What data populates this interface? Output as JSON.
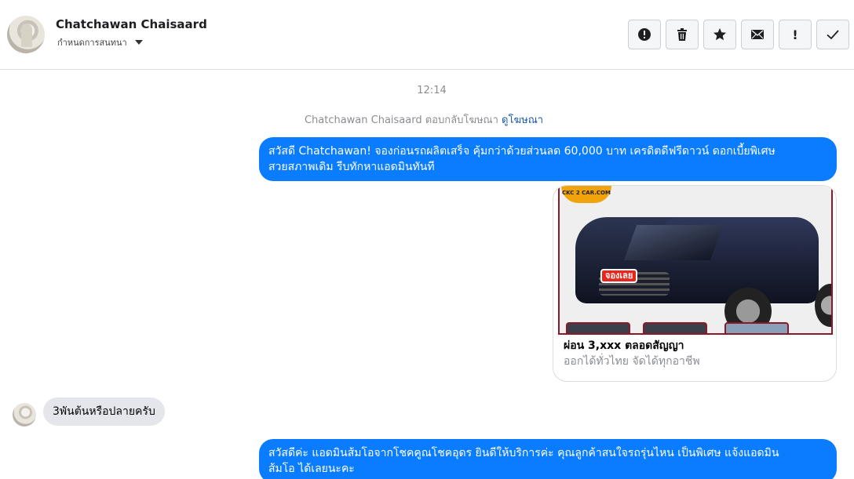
{
  "header": {
    "contact_name": "Chatchawan Chaisaard",
    "conversation_settings_label": "กำหนดการสนทนา"
  },
  "toolbar": {
    "buttons": [
      {
        "name": "report",
        "icon": "alert-circle-icon"
      },
      {
        "name": "delete",
        "icon": "trash-icon"
      },
      {
        "name": "star",
        "icon": "star-icon"
      },
      {
        "name": "mark-unread",
        "icon": "envelope-icon"
      },
      {
        "name": "spam",
        "icon": "exclamation-icon",
        "label": "!"
      },
      {
        "name": "done",
        "icon": "check-icon"
      }
    ]
  },
  "thread": {
    "timestamp": "12:14",
    "ad_reply_prefix": "Chatchawan Chaisaard ตอบกลับโฆษณา",
    "ad_reply_link": "ดูโฆษณา",
    "messages": [
      {
        "direction": "outgoing",
        "text_line1": "สวัสดี Chatchawan! จองก่อนรถผลิตเสร็จ คุ้มกว่าด้วยส่วนลด 60,000 บาท เครดิตดีฟรีดาวน์ ดอกเบี้ยพิเศษ",
        "text_line2": "สวยสภาพเดิม รีบทักหาแอดมินทันที"
      },
      {
        "direction": "incoming",
        "text": "3พันต้นหรือปลายครับ"
      },
      {
        "direction": "outgoing",
        "text_line1": "สวัสดีค่ะ แอดมินส้มโอจากโชคคูณโชคอุดร ยินดีให้บริการค่ะ   คุณลูกค้าสนใจรถรุ่นไหน เป็นพิเศษ แจ้งแอดมิน",
        "text_line2": "ส้มโอ ได้เลยนะคะ"
      }
    ],
    "ad_card": {
      "image_logo_text": "CKC 2 CAR.COM",
      "image_badge_text": "จองเลย",
      "title": "ผ่อน 3,xxx ตลอดสัญญา",
      "subtitle": "ออกได้ทั่วไทย จัดได้ทุกอาชีพ"
    }
  },
  "colors": {
    "outgoing_bubble": "#0a7cff",
    "incoming_bubble": "#e4e6eb",
    "link": "#1b5aa7",
    "meta_text": "#8a8d91"
  }
}
